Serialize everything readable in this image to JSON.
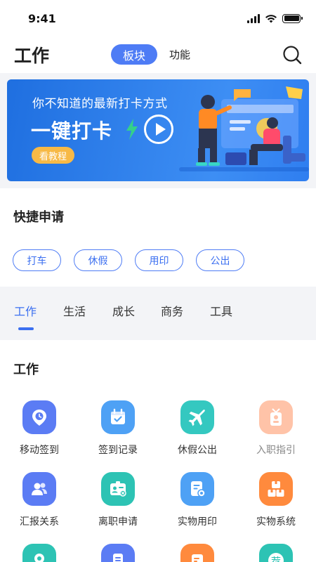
{
  "status_bar": {
    "time": "9:41"
  },
  "header": {
    "title": "工作",
    "segments": [
      {
        "label": "板块",
        "active": true
      },
      {
        "label": "功能",
        "active": false
      }
    ],
    "search_icon": "search-icon"
  },
  "banner": {
    "subtitle": "你不知道的最新打卡方式",
    "title": "一键打卡",
    "button_label": "看教程",
    "colors": {
      "background": "#2f7ef0",
      "button": "#f7b946",
      "bolt": "#35d08a"
    }
  },
  "quick_apply": {
    "title": "快捷申请",
    "chips": [
      "打车",
      "休假",
      "用印",
      "公出"
    ]
  },
  "category_tabs": {
    "items": [
      "工作",
      "生活",
      "成长",
      "商务",
      "工具"
    ],
    "active_index": 0
  },
  "work_section": {
    "title": "工作",
    "apps": [
      {
        "label": "移动签到",
        "icon": "location-clock-icon",
        "color": "#5b7cf4"
      },
      {
        "label": "签到记录",
        "icon": "calendar-check-icon",
        "color": "#4ea1f5"
      },
      {
        "label": "休假公出",
        "icon": "airplane-icon",
        "color": "#34c8c0"
      },
      {
        "label": "入职指引",
        "icon": "badge-icon",
        "color": "#ffc3a8",
        "disabled": true
      },
      {
        "label": "汇报关系",
        "icon": "people-icon",
        "color": "#5b7cf4"
      },
      {
        "label": "离职申请",
        "icon": "id-card-icon",
        "color": "#2dc3b4"
      },
      {
        "label": "实物用印",
        "icon": "document-stamp-icon",
        "color": "#4ea1f5"
      },
      {
        "label": "实物系统",
        "icon": "boxes-icon",
        "color": "#ff8a3d"
      },
      {
        "label": "",
        "icon": "map-pin-icon",
        "color": "#2dc3b4"
      },
      {
        "label": "",
        "icon": "list-icon",
        "color": "#5b7cf4"
      },
      {
        "label": "",
        "icon": "edit-doc-icon",
        "color": "#ff8a3d"
      },
      {
        "label": "",
        "icon": "recommend-icon",
        "color": "#2dc3b4"
      }
    ],
    "row4_partial_text": "荐"
  }
}
